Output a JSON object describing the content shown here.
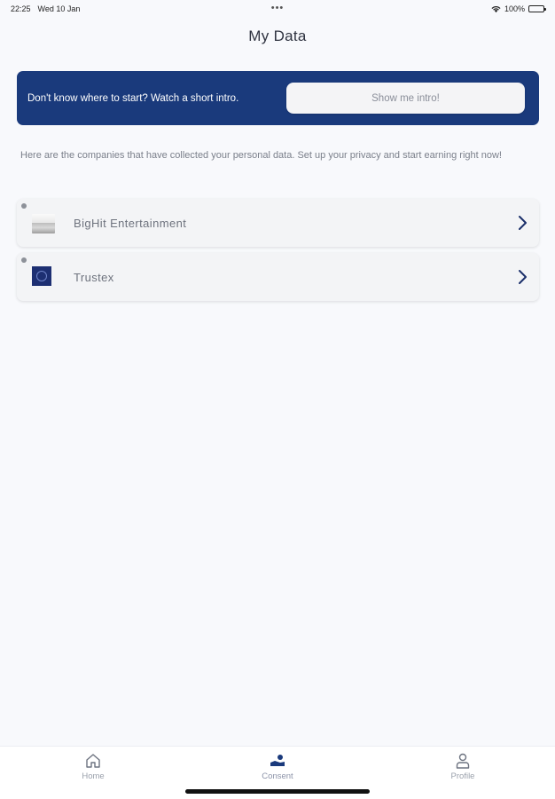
{
  "status_bar": {
    "time": "22:25",
    "date": "Wed 10 Jan",
    "dots": "•••",
    "battery": "100%"
  },
  "header": {
    "title": "My Data"
  },
  "intro_banner": {
    "text": "Don't know where to start? Watch a short intro.",
    "button_label": "Show me intro!"
  },
  "description": "Here are the companies that have collected your personal data. Set up your privacy and start earning right now!",
  "companies": [
    {
      "name": "BigHit Entertainment",
      "logo_icon": "bighit-logo-icon"
    },
    {
      "name": "Trustex",
      "logo_icon": "trustex-logo-icon"
    }
  ],
  "tab_bar": {
    "tabs": [
      {
        "label": "Home",
        "icon": "home-icon"
      },
      {
        "label": "Consent",
        "icon": "consent-icon",
        "active": true
      },
      {
        "label": "Profile",
        "icon": "profile-icon"
      }
    ]
  },
  "colors": {
    "brand": "#1a3a7c",
    "background": "#f8f9fc",
    "card": "#f3f4f6"
  }
}
